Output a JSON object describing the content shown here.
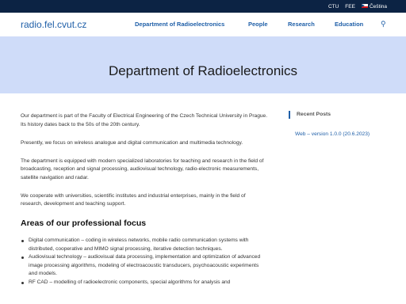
{
  "topbar": {
    "links": [
      "CTU",
      "FEE"
    ],
    "language": "Čeština",
    "language_flag": "czech-flag"
  },
  "header": {
    "site_title": "radio.fel.cvut.cz",
    "nav": [
      "Department of Radioelectronics",
      "People",
      "Research",
      "Education"
    ],
    "search_icon": "search-icon"
  },
  "hero": {
    "title": "Department of Radioelectronics"
  },
  "main": {
    "paragraphs": [
      "Our department is part of the Faculty of Electrical Engineering of the Czech Technical University in Prague. Its history dates back to the 50s of the 20th century.",
      "Presently, we focus on wireless analogue and digital communication and multimedia technology.",
      "The department is equipped with modern specialized laboratories for teaching and research in the field of broadcasting, reception and signal processing, audiovisual technology, radio-electronic measurements, satellite navigation and radar.",
      "We cooperate with universities, scientific institutes and industrial enterprises, mainly in the field of research, development and teaching support."
    ],
    "focus_heading": "Areas of our professional focus",
    "focus_items": [
      "Digital communication – coding in wireless networks, mobile radio communication systems with distributed, cooperative and MIMO signal processing, iterative detection techniques.",
      "Audiovisual technology – audiovisual data processing, implementation and optimization of advanced image processing algorithms, modeling of electroacoustic transducers, psychoacoustic experiments and models.",
      "RF CAD – modelling of radioelectronic components, special algorithms for analysis and"
    ]
  },
  "sidebar": {
    "recent_posts_title": "Recent Posts",
    "posts": [
      "Web – version 1.0.0 (20.6.2023)"
    ]
  },
  "colors": {
    "topbar_bg": "#0c2344",
    "hero_bg": "#cfdcf9",
    "link": "#1f5fa8"
  }
}
